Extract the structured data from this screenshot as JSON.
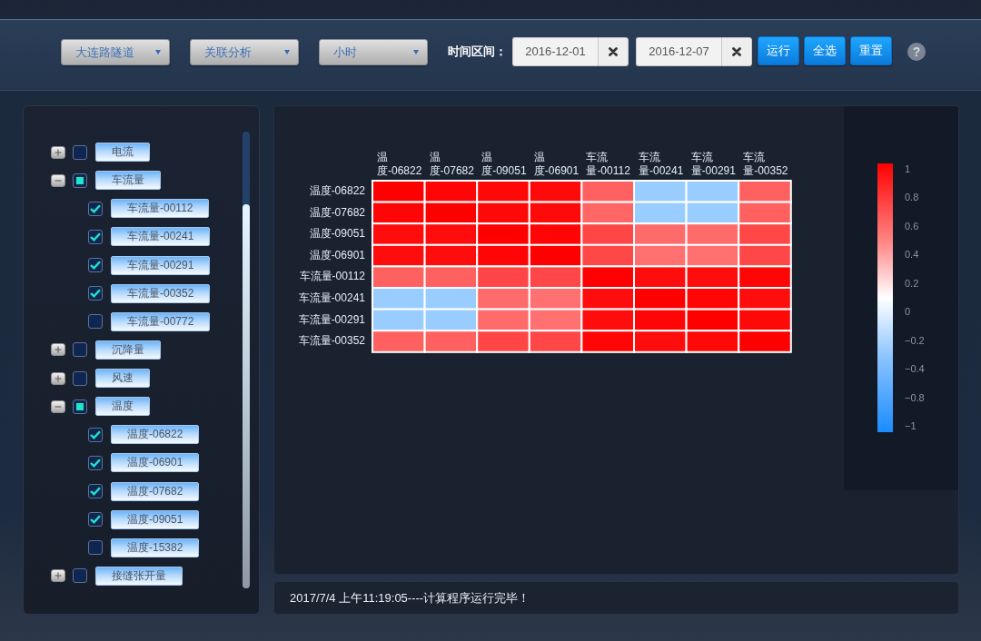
{
  "toolbar": {
    "dropdowns": [
      {
        "value": "大连路隧道"
      },
      {
        "value": "关联分析"
      },
      {
        "value": "小时"
      }
    ],
    "range_label": "时间区间：",
    "dates": [
      {
        "value": "2016-12-01"
      },
      {
        "value": "2016-12-07"
      }
    ],
    "buttons": [
      {
        "label": "运行"
      },
      {
        "label": "全选"
      },
      {
        "label": "重置"
      }
    ],
    "help": "?"
  },
  "tree": [
    {
      "label": "电流",
      "expanded": false,
      "checked": false,
      "partial": false
    },
    {
      "label": "车流量",
      "expanded": true,
      "checked": false,
      "partial": true,
      "children": [
        {
          "label": "车流量-00112",
          "checked": true
        },
        {
          "label": "车流量-00241",
          "checked": true
        },
        {
          "label": "车流量-00291",
          "checked": true
        },
        {
          "label": "车流量-00352",
          "checked": true
        },
        {
          "label": "车流量-00772",
          "checked": false
        }
      ]
    },
    {
      "label": "沉降量",
      "expanded": false,
      "checked": false,
      "partial": false
    },
    {
      "label": "风速",
      "expanded": false,
      "checked": false,
      "partial": false
    },
    {
      "label": "温度",
      "expanded": true,
      "checked": false,
      "partial": true,
      "children": [
        {
          "label": "温度-06822",
          "checked": true
        },
        {
          "label": "温度-06901",
          "checked": true
        },
        {
          "label": "温度-07682",
          "checked": true
        },
        {
          "label": "温度-09051",
          "checked": true
        },
        {
          "label": "温度-15382",
          "checked": false
        }
      ]
    },
    {
      "label": "接缝张开量",
      "expanded": false,
      "checked": false,
      "partial": false
    }
  ],
  "chart": {
    "heatmap": {
      "columns": [
        "温度-06822",
        "温度-07682",
        "温度-09051",
        "温度-06901",
        "车流量-00112",
        "车流量-00241",
        "车流量-00291",
        "车流量-00352"
      ],
      "rows": [
        {
          "label": "温度-06822",
          "cells": [
            {
              "color": "#ff0000"
            },
            {
              "color": "#ff0505"
            },
            {
              "color": "#ff0808"
            },
            {
              "color": "#ff0a0a"
            },
            {
              "color": "#ff6161"
            },
            {
              "color": "#9acdff"
            },
            {
              "color": "#9acdff"
            },
            {
              "color": "#ff6161"
            }
          ]
        },
        {
          "label": "温度-07682",
          "cells": [
            {
              "color": "#ff0505"
            },
            {
              "color": "#ff0000"
            },
            {
              "color": "#ff0808"
            },
            {
              "color": "#ff0a0a"
            },
            {
              "color": "#ff6666"
            },
            {
              "color": "#9acdff"
            },
            {
              "color": "#9acdff"
            },
            {
              "color": "#ff6161"
            }
          ]
        },
        {
          "label": "温度-09051",
          "cells": [
            {
              "color": "#ff0d0d"
            },
            {
              "color": "#ff0d0d"
            },
            {
              "color": "#ff0000"
            },
            {
              "color": "#ff0505"
            },
            {
              "color": "#ff4545"
            },
            {
              "color": "#ff6b6b"
            },
            {
              "color": "#ff6b6b"
            },
            {
              "color": "#ff4747"
            }
          ]
        },
        {
          "label": "温度-06901",
          "cells": [
            {
              "color": "#ff0d0d"
            },
            {
              "color": "#ff0d0d"
            },
            {
              "color": "#ff0505"
            },
            {
              "color": "#ff0000"
            },
            {
              "color": "#ff4747"
            },
            {
              "color": "#ff7070"
            },
            {
              "color": "#ff7070"
            },
            {
              "color": "#ff4747"
            }
          ]
        },
        {
          "label": "车流量-00112",
          "cells": [
            {
              "color": "#ff6161"
            },
            {
              "color": "#ff6161"
            },
            {
              "color": "#ff4545"
            },
            {
              "color": "#ff4747"
            },
            {
              "color": "#ff0000"
            },
            {
              "color": "#ff0d0d"
            },
            {
              "color": "#ff0d0d"
            },
            {
              "color": "#ff0505"
            }
          ]
        },
        {
          "label": "车流量-00241",
          "cells": [
            {
              "color": "#9acdff"
            },
            {
              "color": "#9acdff"
            },
            {
              "color": "#ff6b6b"
            },
            {
              "color": "#ff7070"
            },
            {
              "color": "#ff0d0d"
            },
            {
              "color": "#ff0000"
            },
            {
              "color": "#ff0505"
            },
            {
              "color": "#ff0d0d"
            }
          ]
        },
        {
          "label": "车流量-00291",
          "cells": [
            {
              "color": "#9acdff"
            },
            {
              "color": "#9acdff"
            },
            {
              "color": "#ff6b6b"
            },
            {
              "color": "#ff7070"
            },
            {
              "color": "#ff0d0d"
            },
            {
              "color": "#ff0505"
            },
            {
              "color": "#ff0000"
            },
            {
              "color": "#ff0808"
            }
          ]
        },
        {
          "label": "车流量-00352",
          "cells": [
            {
              "color": "#ff6161"
            },
            {
              "color": "#ff6161"
            },
            {
              "color": "#ff4545"
            },
            {
              "color": "#ff4747"
            },
            {
              "color": "#ff0505"
            },
            {
              "color": "#ff0d0d"
            },
            {
              "color": "#ff0808"
            },
            {
              "color": "#ff0000"
            }
          ]
        }
      ]
    },
    "color_scale": {
      "labels": [
        "1",
        "0.8",
        "0.6",
        "0.4",
        "0.2",
        "0",
        "−0.2",
        "−0.4",
        "−0.8",
        "−1"
      ]
    }
  },
  "status_bar": {
    "message": "2017/7/4 上午11:19:05----计算程序运行完毕！"
  }
}
